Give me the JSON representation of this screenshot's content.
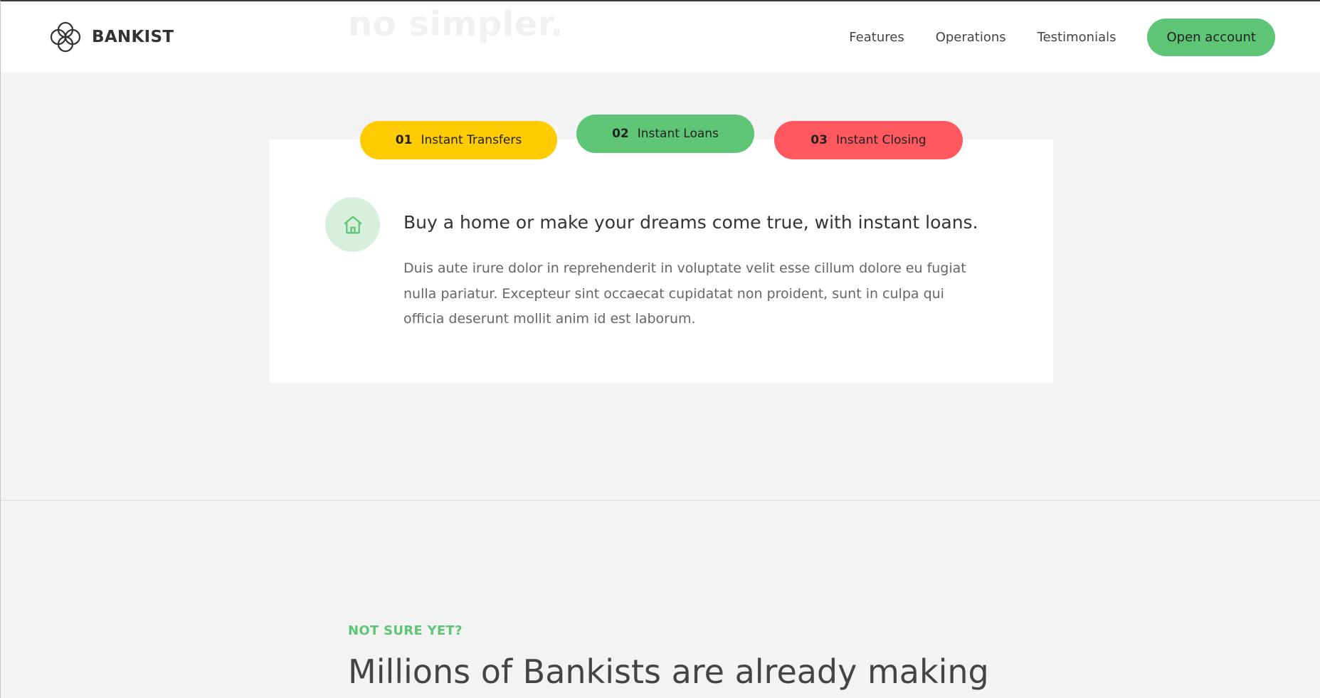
{
  "header": {
    "ghost_heading": "no simpler.",
    "logo_text": "BANKIST",
    "nav_links": [
      "Features",
      "Operations",
      "Testimonials"
    ],
    "cta_label": "Open account"
  },
  "operations": {
    "tabs": [
      {
        "number": "01",
        "label": "Instant Transfers",
        "color": "#ffcb03"
      },
      {
        "number": "02",
        "label": "Instant Loans",
        "color": "#5ec576",
        "active": true
      },
      {
        "number": "03",
        "label": "Instant Closing",
        "color": "#ff585f"
      }
    ],
    "content": {
      "icon": "home-icon",
      "title": "Buy a home or make your dreams come true, with instant loans.",
      "text": "Duis aute irure dolor in reprehenderit in voluptate velit esse cillum dolore eu fugiat nulla pariatur. Excepteur sint occaecat cupidatat non proident, sunt in culpa qui officia deserunt mollit anim id est laborum."
    }
  },
  "next_section": {
    "label": "NOT SURE YET?",
    "heading": "Millions of Bankists are already making"
  },
  "colors": {
    "accent": "#5ec576",
    "yellow": "#ffcb03",
    "red": "#ff585f",
    "background": "#f3f3f3"
  }
}
